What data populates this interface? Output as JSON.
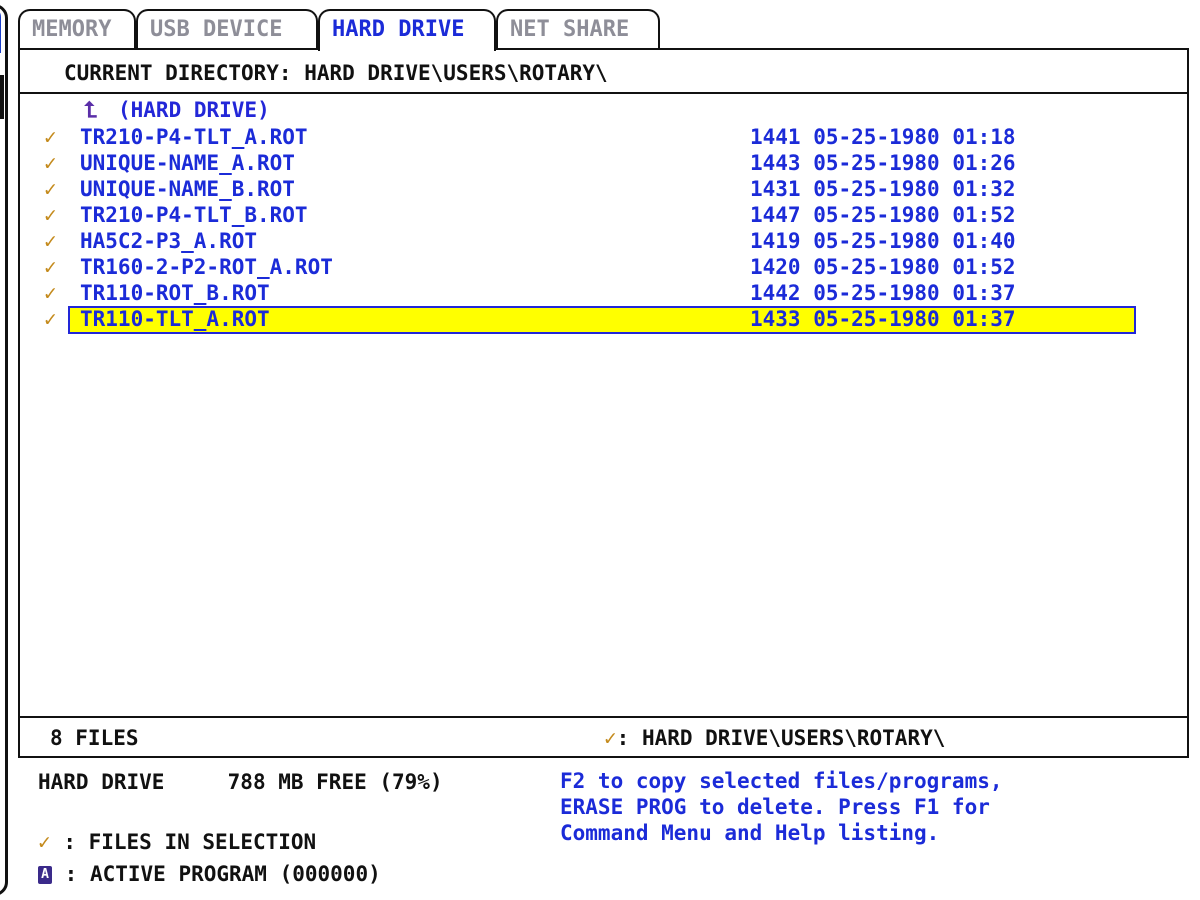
{
  "tabs": [
    {
      "label": "MEMORY",
      "active": false
    },
    {
      "label": "USB DEVICE",
      "active": false
    },
    {
      "label": "HARD DRIVE",
      "active": true
    },
    {
      "label": "NET SHARE",
      "active": false
    }
  ],
  "current_directory": "CURRENT DIRECTORY: HARD DRIVE\\USERS\\ROTARY\\",
  "up_entry": "(HARD DRIVE)",
  "files": [
    {
      "name": "TR210-P4-TLT_A.ROT",
      "size": "1441",
      "date": "05-25-1980",
      "time": "01:18",
      "checked": true,
      "selected": false
    },
    {
      "name": "UNIQUE-NAME_A.ROT",
      "size": "1443",
      "date": "05-25-1980",
      "time": "01:26",
      "checked": true,
      "selected": false
    },
    {
      "name": "UNIQUE-NAME_B.ROT",
      "size": "1431",
      "date": "05-25-1980",
      "time": "01:32",
      "checked": true,
      "selected": false
    },
    {
      "name": "TR210-P4-TLT_B.ROT",
      "size": "1447",
      "date": "05-25-1980",
      "time": "01:52",
      "checked": true,
      "selected": false
    },
    {
      "name": "HA5C2-P3_A.ROT",
      "size": "1419",
      "date": "05-25-1980",
      "time": "01:40",
      "checked": true,
      "selected": false
    },
    {
      "name": "TR160-2-P2-ROT_A.ROT",
      "size": "1420",
      "date": "05-25-1980",
      "time": "01:52",
      "checked": true,
      "selected": false
    },
    {
      "name": "TR110-ROT_B.ROT",
      "size": "1442",
      "date": "05-25-1980",
      "time": "01:37",
      "checked": true,
      "selected": false
    },
    {
      "name": "TR110-TLT_A.ROT",
      "size": "1433",
      "date": "05-25-1980",
      "time": "01:37",
      "checked": true,
      "selected": true
    }
  ],
  "footer": {
    "file_count": "8 FILES",
    "selection_path": ": HARD DRIVE\\USERS\\ROTARY\\"
  },
  "drive_info": {
    "name": "HARD DRIVE",
    "free": "788 MB FREE (79%)"
  },
  "legend": {
    "files_in_selection": ": FILES IN SELECTION",
    "active_program_icon_letter": "A",
    "active_program": ": ACTIVE PROGRAM (000000)"
  },
  "help_text": "F2 to copy selected files/programs,\nERASE PROG to delete. Press F1 for\nCommand Menu and Help listing.",
  "colors": {
    "text_blue": "#1b2bd8",
    "check_orange": "#c48a1c",
    "highlight_yellow": "#ffff00",
    "inactive_tab": "#8e8e98"
  },
  "icons": {
    "check": "checkmark-icon",
    "up": "up-arrow-icon",
    "active_program": "active-program-icon"
  }
}
